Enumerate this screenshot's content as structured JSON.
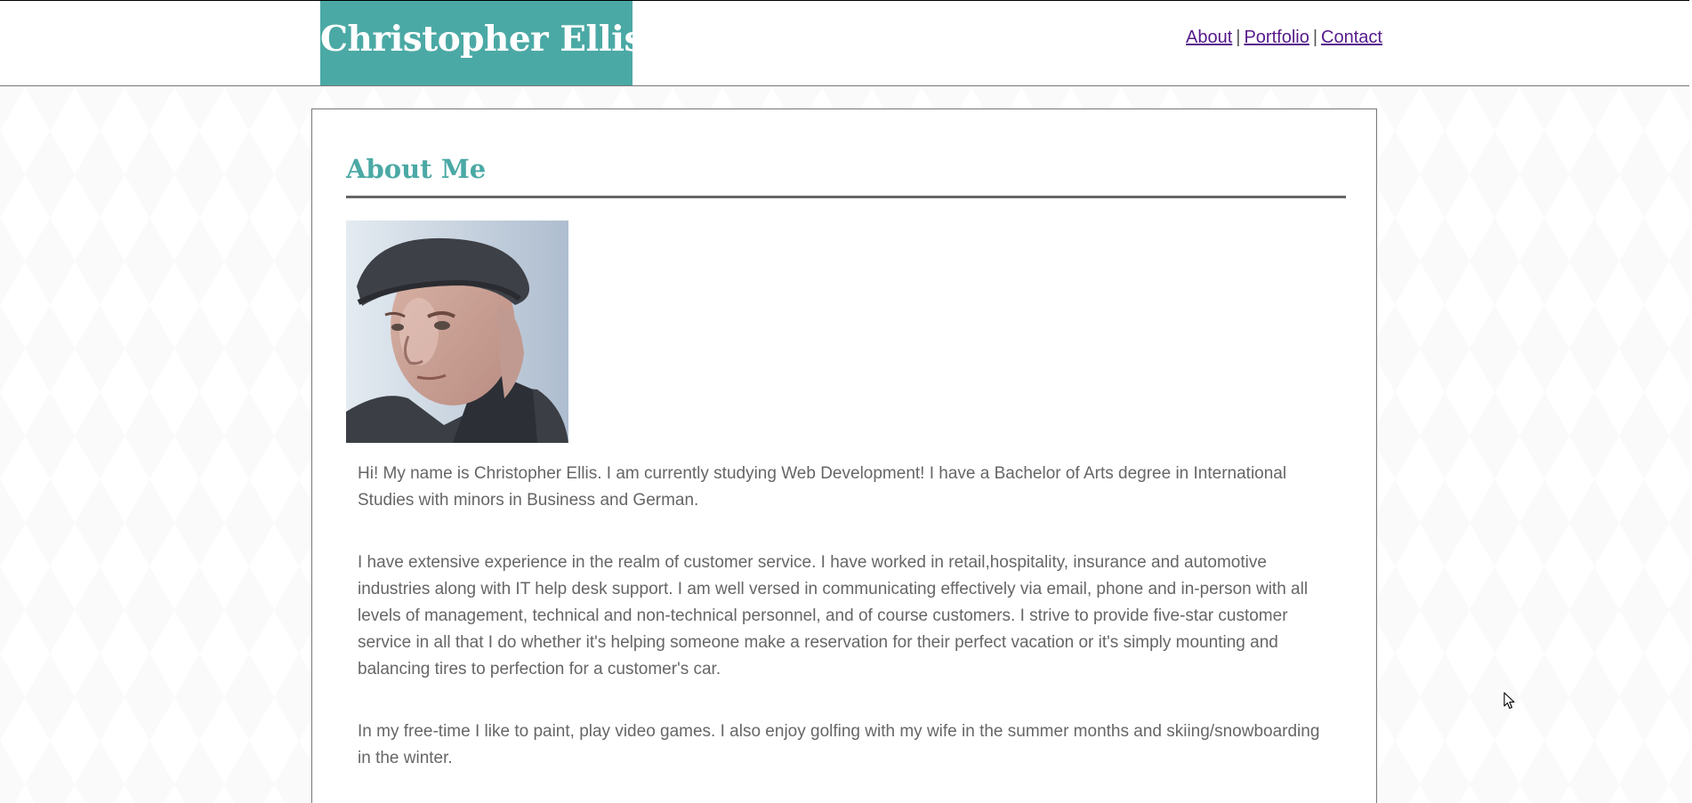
{
  "header": {
    "site_title": "Christopher Ellis",
    "nav": {
      "about": "About",
      "portfolio": "Portfolio",
      "contact": "Contact",
      "separator": "|"
    }
  },
  "main": {
    "heading": "About Me",
    "paragraphs": [
      "Hi! My name is Christopher Ellis. I am currently studying Web Development! I have a Bachelor of Arts degree in International Studies with minors in Business and German.",
      "I have extensive experience in the realm of customer service. I have worked in retail,hospitality, insurance and automotive industries along with IT help desk support. I am well versed in communicating effectively via email, phone and in-person with all levels of management, technical and non-technical personnel, and of course customers. I strive to provide five-star customer service in all that I do whether it's helping someone make a reservation for their perfect vacation or it's simply mounting and balancing tires to perfection for a customer's car.",
      "In my free-time I like to paint, play video games. I also enjoy golfing with my wife in the summer months and skiing/snowboarding in the winter."
    ]
  },
  "colors": {
    "accent": "#4ba9a5",
    "link": "#551a8b",
    "body_text": "#666666"
  },
  "icons": {
    "cursor": "mouse-pointer-icon"
  }
}
